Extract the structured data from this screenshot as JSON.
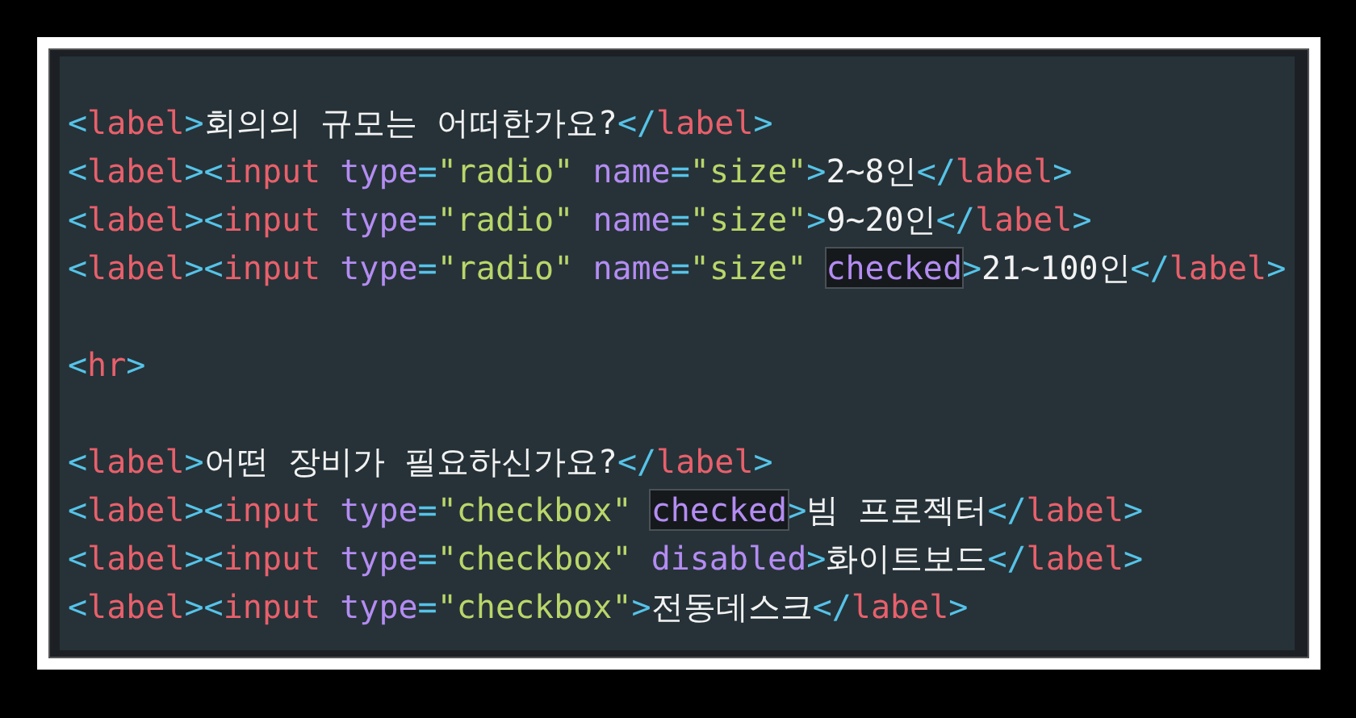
{
  "code_lines": [
    {
      "kind": "code",
      "tokens": [
        {
          "kind": "punct",
          "text": "<"
        },
        {
          "kind": "tag",
          "text": "label"
        },
        {
          "kind": "punct",
          "text": ">"
        },
        {
          "kind": "text",
          "text": "회의의 규모는 어떠한가요?"
        },
        {
          "kind": "punct",
          "text": "</"
        },
        {
          "kind": "tag",
          "text": "label"
        },
        {
          "kind": "punct",
          "text": ">"
        }
      ]
    },
    {
      "kind": "code",
      "tokens": [
        {
          "kind": "punct",
          "text": "<"
        },
        {
          "kind": "tag",
          "text": "label"
        },
        {
          "kind": "punct",
          "text": "><"
        },
        {
          "kind": "tag",
          "text": "input"
        },
        {
          "kind": "attr",
          "text": " type"
        },
        {
          "kind": "punct",
          "text": "="
        },
        {
          "kind": "string",
          "text": "\"radio\""
        },
        {
          "kind": "attr",
          "text": " name"
        },
        {
          "kind": "punct",
          "text": "="
        },
        {
          "kind": "string",
          "text": "\"size\""
        },
        {
          "kind": "punct",
          "text": ">"
        },
        {
          "kind": "text",
          "text": "2~8인"
        },
        {
          "kind": "punct",
          "text": "</"
        },
        {
          "kind": "tag",
          "text": "label"
        },
        {
          "kind": "punct",
          "text": ">"
        }
      ]
    },
    {
      "kind": "code",
      "tokens": [
        {
          "kind": "punct",
          "text": "<"
        },
        {
          "kind": "tag",
          "text": "label"
        },
        {
          "kind": "punct",
          "text": "><"
        },
        {
          "kind": "tag",
          "text": "input"
        },
        {
          "kind": "attr",
          "text": " type"
        },
        {
          "kind": "punct",
          "text": "="
        },
        {
          "kind": "string",
          "text": "\"radio\""
        },
        {
          "kind": "attr",
          "text": " name"
        },
        {
          "kind": "punct",
          "text": "="
        },
        {
          "kind": "string",
          "text": "\"size\""
        },
        {
          "kind": "punct",
          "text": ">"
        },
        {
          "kind": "text",
          "text": "9~20인"
        },
        {
          "kind": "punct",
          "text": "</"
        },
        {
          "kind": "tag",
          "text": "label"
        },
        {
          "kind": "punct",
          "text": ">"
        }
      ]
    },
    {
      "kind": "code",
      "tokens": [
        {
          "kind": "punct",
          "text": "<"
        },
        {
          "kind": "tag",
          "text": "label"
        },
        {
          "kind": "punct",
          "text": "><"
        },
        {
          "kind": "tag",
          "text": "input"
        },
        {
          "kind": "attr",
          "text": " type"
        },
        {
          "kind": "punct",
          "text": "="
        },
        {
          "kind": "string",
          "text": "\"radio\""
        },
        {
          "kind": "attr",
          "text": " name"
        },
        {
          "kind": "punct",
          "text": "="
        },
        {
          "kind": "string",
          "text": "\"size\""
        },
        {
          "kind": "marked",
          "text": " checked"
        },
        {
          "kind": "punct",
          "text": ">"
        },
        {
          "kind": "text",
          "text": "21~100인"
        },
        {
          "kind": "punct",
          "text": "</"
        },
        {
          "kind": "tag",
          "text": "label"
        },
        {
          "kind": "punct",
          "text": ">"
        }
      ]
    },
    {
      "kind": "blank"
    },
    {
      "kind": "code",
      "tokens": [
        {
          "kind": "punct",
          "text": "<"
        },
        {
          "kind": "tag",
          "text": "hr"
        },
        {
          "kind": "punct",
          "text": ">"
        }
      ]
    },
    {
      "kind": "blank"
    },
    {
      "kind": "code",
      "tokens": [
        {
          "kind": "punct",
          "text": "<"
        },
        {
          "kind": "tag",
          "text": "label"
        },
        {
          "kind": "punct",
          "text": ">"
        },
        {
          "kind": "text",
          "text": "어떤 장비가 필요하신가요?"
        },
        {
          "kind": "punct",
          "text": "</"
        },
        {
          "kind": "tag",
          "text": "label"
        },
        {
          "kind": "punct",
          "text": ">"
        }
      ]
    },
    {
      "kind": "code",
      "tokens": [
        {
          "kind": "punct",
          "text": "<"
        },
        {
          "kind": "tag",
          "text": "label"
        },
        {
          "kind": "punct",
          "text": "><"
        },
        {
          "kind": "tag",
          "text": "input"
        },
        {
          "kind": "attr",
          "text": " type"
        },
        {
          "kind": "punct",
          "text": "="
        },
        {
          "kind": "string",
          "text": "\"checkbox\""
        },
        {
          "kind": "marked",
          "text": " checked"
        },
        {
          "kind": "punct",
          "text": ">"
        },
        {
          "kind": "text",
          "text": "빔 프로젝터"
        },
        {
          "kind": "punct",
          "text": "</"
        },
        {
          "kind": "tag",
          "text": "label"
        },
        {
          "kind": "punct",
          "text": ">"
        }
      ]
    },
    {
      "kind": "code",
      "tokens": [
        {
          "kind": "punct",
          "text": "<"
        },
        {
          "kind": "tag",
          "text": "label"
        },
        {
          "kind": "punct",
          "text": "><"
        },
        {
          "kind": "tag",
          "text": "input"
        },
        {
          "kind": "attr",
          "text": " type"
        },
        {
          "kind": "punct",
          "text": "="
        },
        {
          "kind": "string",
          "text": "\"checkbox\""
        },
        {
          "kind": "attr",
          "text": " disabled"
        },
        {
          "kind": "punct",
          "text": ">"
        },
        {
          "kind": "text",
          "text": "화이트보드"
        },
        {
          "kind": "punct",
          "text": "</"
        },
        {
          "kind": "tag",
          "text": "label"
        },
        {
          "kind": "punct",
          "text": ">"
        }
      ]
    },
    {
      "kind": "code",
      "tokens": [
        {
          "kind": "punct",
          "text": "<"
        },
        {
          "kind": "tag",
          "text": "label"
        },
        {
          "kind": "punct",
          "text": "><"
        },
        {
          "kind": "tag",
          "text": "input"
        },
        {
          "kind": "attr",
          "text": " type"
        },
        {
          "kind": "punct",
          "text": "="
        },
        {
          "kind": "string",
          "text": "\"checkbox\""
        },
        {
          "kind": "punct",
          "text": ">"
        },
        {
          "kind": "text",
          "text": "전동데스크"
        },
        {
          "kind": "punct",
          "text": "</"
        },
        {
          "kind": "tag",
          "text": "label"
        },
        {
          "kind": "punct",
          "text": ">"
        }
      ]
    }
  ]
}
